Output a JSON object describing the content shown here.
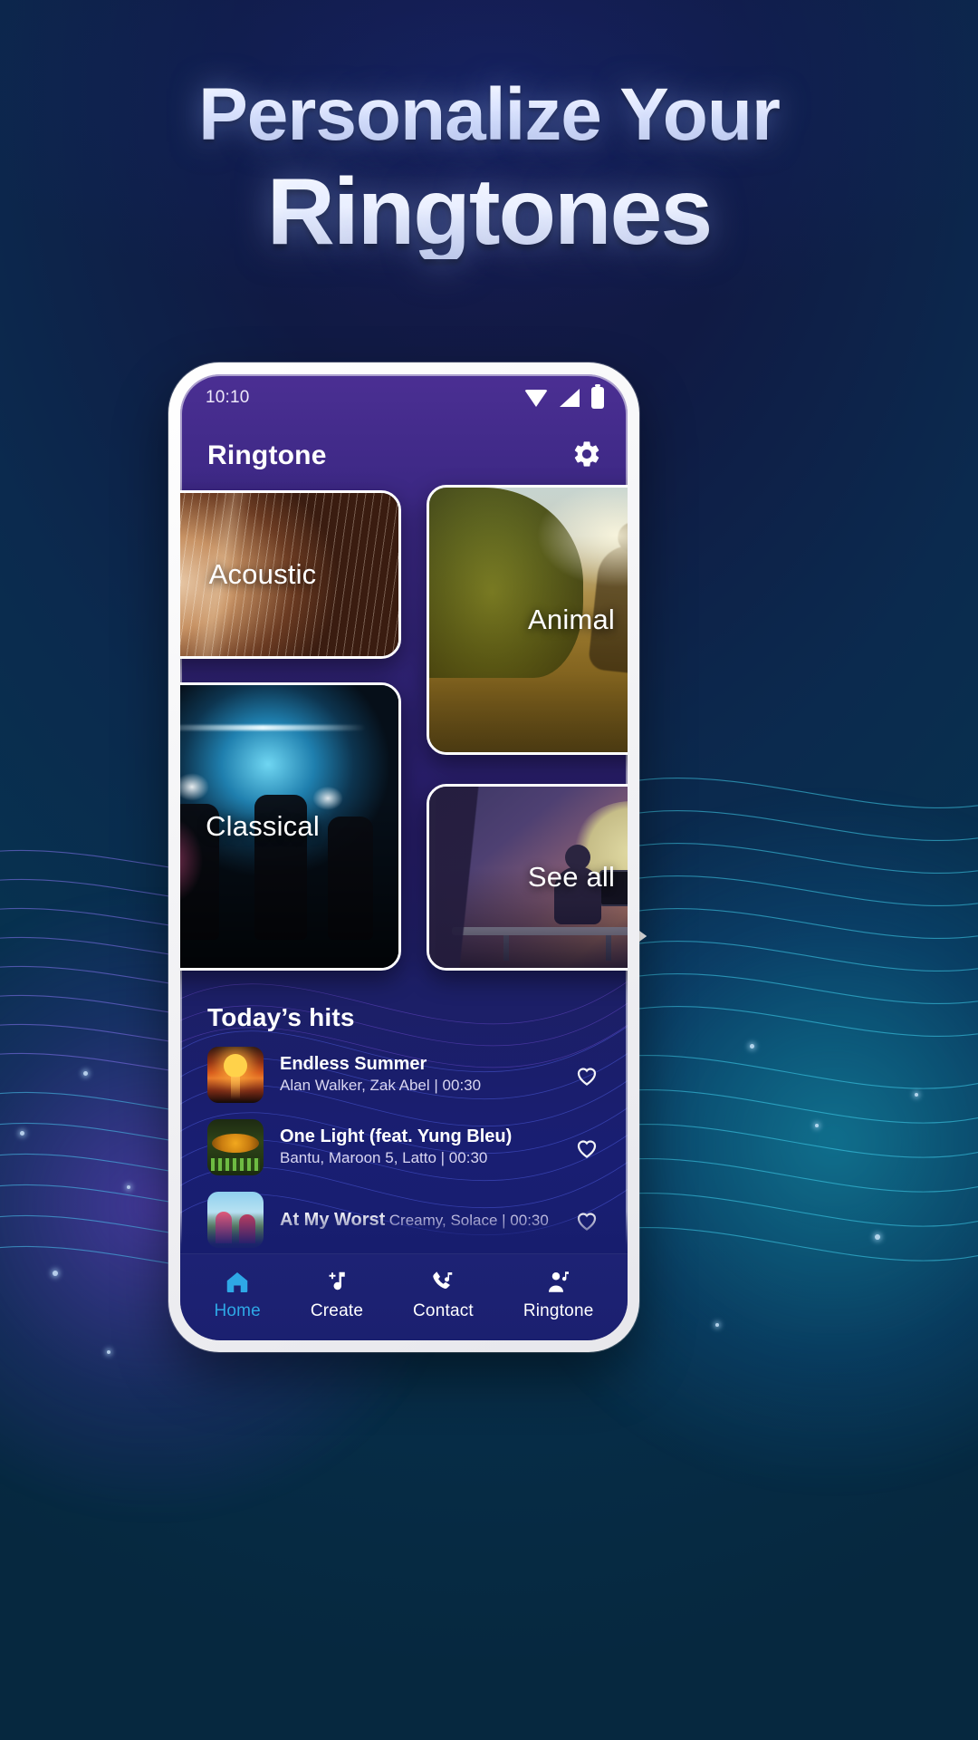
{
  "promo": {
    "headline_line1": "Personalize Your",
    "headline_line2": "Ringtones"
  },
  "phone": {
    "status_bar": {
      "time": "10:10",
      "icons": [
        "wifi-icon",
        "signal-icon",
        "battery-icon"
      ]
    },
    "app_bar": {
      "title": "Ringtone",
      "settings_icon": "gear-icon"
    },
    "categories": [
      {
        "label": "Acoustic",
        "art": "acoustic-guitar-photo"
      },
      {
        "label": "Animal",
        "art": "runner-sunset-photo"
      },
      {
        "label": "Classical",
        "art": "band-on-stage-photo"
      },
      {
        "label": "See all",
        "art": "office-illustration"
      }
    ],
    "hits": {
      "title": "Today’s hits",
      "songs": [
        {
          "title": "Endless Summer",
          "subtitle": "Alan Walker, Zak Abel | 00:30",
          "artist": "Alan Walker, Zak Abel",
          "duration": "00:30",
          "thumb": "sunset-album-art",
          "favorite_icon": "heart-outline-icon"
        },
        {
          "title": "One Light (feat. Yung Bleu)",
          "subtitle": "Bantu, Maroon 5, Latto | 00:30",
          "artist": "Bantu, Maroon 5, Latto",
          "duration": "00:30",
          "thumb": "one-light-remix-album-art",
          "favorite_icon": "heart-outline-icon"
        },
        {
          "title": "At My Worst",
          "subtitle": "Creamy, Solace | 00:30",
          "artist": "Creamy, Solace",
          "duration": "00:30",
          "thumb": "at-my-worst-album-art",
          "favorite_icon": "heart-outline-icon"
        }
      ]
    },
    "bottom_nav": {
      "items": [
        {
          "label": "Home",
          "icon": "home-icon",
          "active": true
        },
        {
          "label": "Create",
          "icon": "music-note-plus-icon",
          "active": false
        },
        {
          "label": "Contact",
          "icon": "phone-music-icon",
          "active": false
        },
        {
          "label": "Ringtone",
          "icon": "person-music-icon",
          "active": false
        }
      ]
    }
  },
  "colors": {
    "accent_active": "#2EA8E6",
    "app_purple": "#4B2F93",
    "deep_navy": "#171D6E",
    "bg_top": "#17194A",
    "bg_bottom": "#06283F",
    "wave_cyan": "#2BC4E0",
    "wave_violet": "#7A4BE0"
  }
}
